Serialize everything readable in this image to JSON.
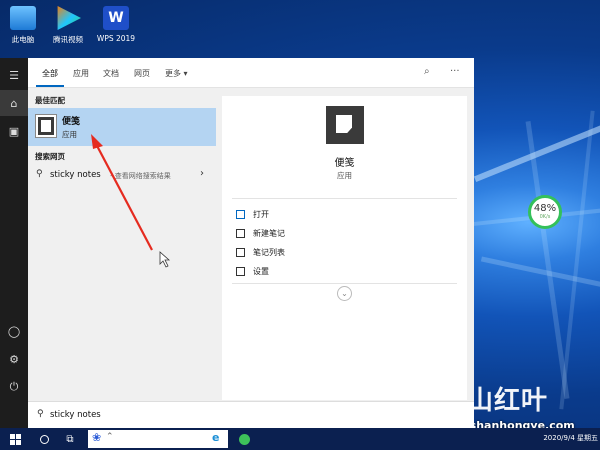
{
  "desktop": {
    "icons": [
      {
        "label": "此电脑",
        "icon": "computer-icon"
      },
      {
        "label": "腾讯视频",
        "icon": "tencent-video-icon"
      },
      {
        "label": "WPS 2019",
        "icon": "wps-icon"
      }
    ],
    "cpu_widget": {
      "value": "48%",
      "sub": "0K/s"
    },
    "watermark": {
      "text": "深山红叶",
      "url": "shenshanhongye.com"
    }
  },
  "rail": {
    "items": [
      "hamburger-icon",
      "home-icon",
      "documents-icon",
      "user-icon",
      "settings-icon",
      "power-icon"
    ]
  },
  "search": {
    "tabs": [
      "全部",
      "应用",
      "文档",
      "网页",
      "更多"
    ],
    "active_tab": "全部",
    "sections": {
      "best_match": "最佳匹配",
      "web": "搜索网页"
    },
    "best_match": {
      "title": "便笺",
      "subtitle": "应用"
    },
    "web_result": {
      "query": "sticky notes",
      "hint": "- 查看网络搜索结果"
    },
    "detail": {
      "title": "便笺",
      "subtitle": "应用",
      "actions": [
        "打开",
        "新建笔记",
        "笔记列表",
        "设置"
      ]
    },
    "query_value": "sticky notes"
  },
  "colors": {
    "highlight": "#b4d4f2",
    "accent": "#0067c0",
    "arrow": "#e52b20",
    "taskbar": "#0b2050"
  },
  "taskbar": {
    "date": "2020/9/4 星期五"
  }
}
